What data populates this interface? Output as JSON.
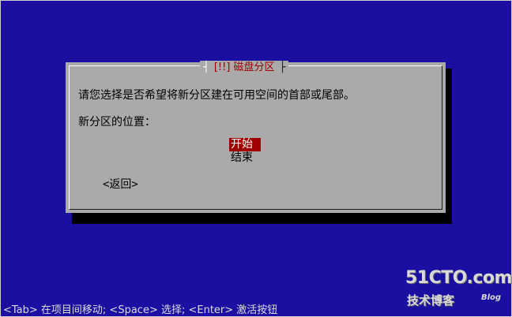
{
  "dialog": {
    "title": "磁盘分区",
    "title_marker": "[!!]",
    "question": "请您选择是否希望将新分区建在可用空间的首部或尾部。",
    "position_label": "新分区的位置：",
    "options": [
      {
        "label": "开始",
        "selected": true
      },
      {
        "label": "结束",
        "selected": false
      }
    ],
    "back_button": "<返回>"
  },
  "status_bar": "<Tab> 在项目间移动; <Space> 选择; <Enter> 激活按钮",
  "watermark": {
    "main": "51CTO.com",
    "sub": "技术博客",
    "tag": "Blog"
  },
  "colors": {
    "background": "#1a0fa0",
    "dialog": "#aaaaaa",
    "accent": "#a00000"
  }
}
